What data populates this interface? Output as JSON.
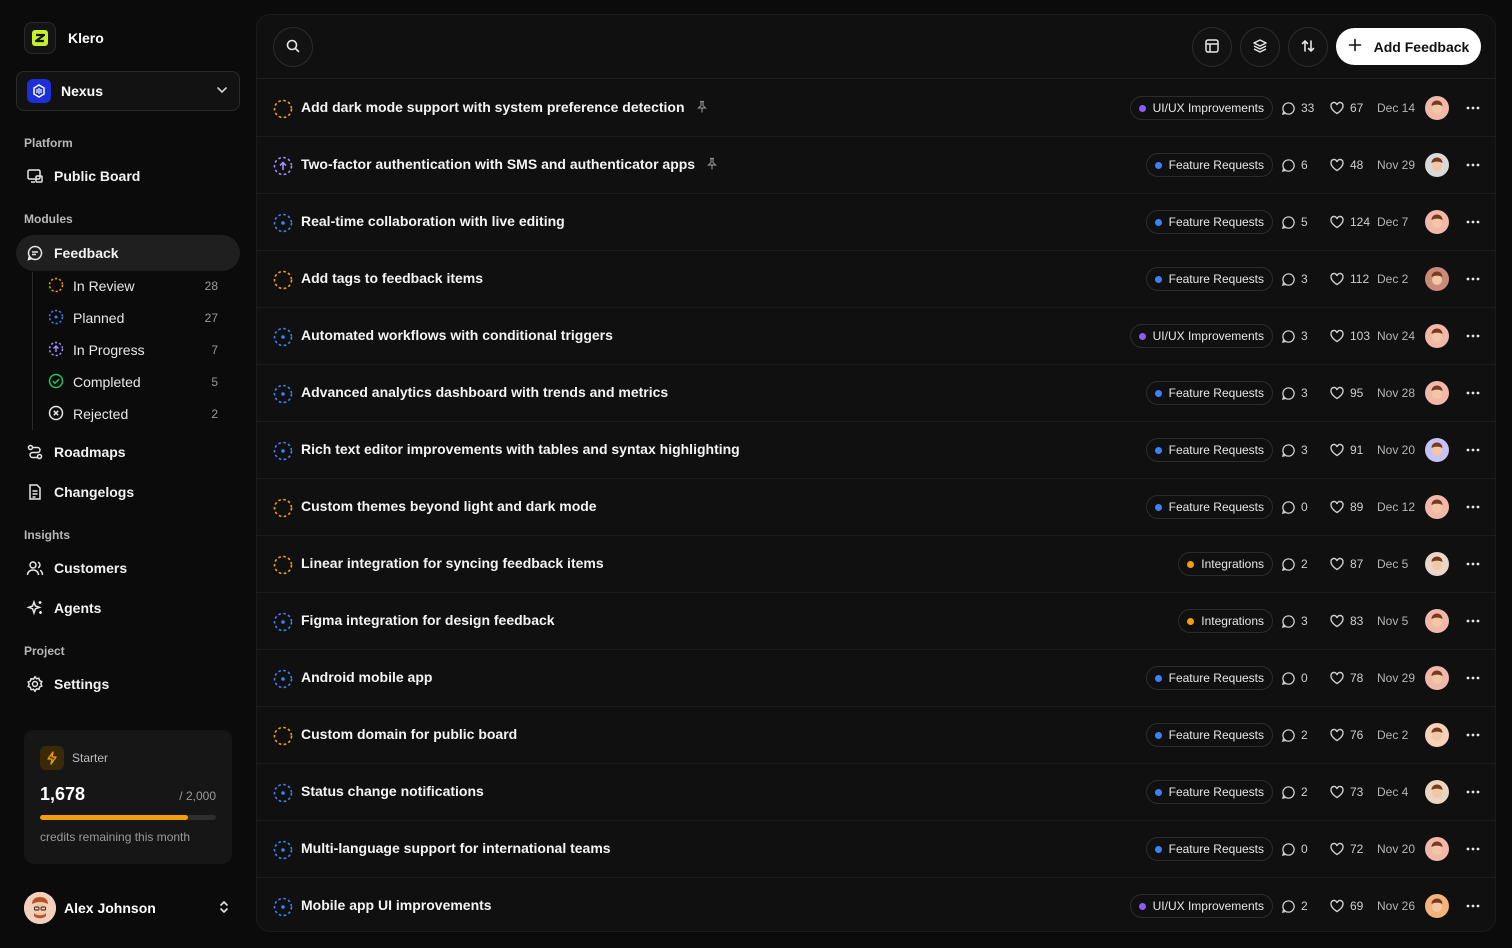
{
  "brand": {
    "name": "Klero"
  },
  "project": {
    "name": "Nexus"
  },
  "sidebar": {
    "platform_label": "Platform",
    "public_board": "Public Board",
    "modules_label": "Modules",
    "feedback": "Feedback",
    "statuses": [
      {
        "label": "In Review",
        "count": "28",
        "icon": "in-review-icon"
      },
      {
        "label": "Planned",
        "count": "27",
        "icon": "planned-icon"
      },
      {
        "label": "In Progress",
        "count": "7",
        "icon": "in-progress-icon"
      },
      {
        "label": "Completed",
        "count": "5",
        "icon": "completed-icon"
      },
      {
        "label": "Rejected",
        "count": "2",
        "icon": "rejected-icon"
      }
    ],
    "roadmaps": "Roadmaps",
    "changelogs": "Changelogs",
    "insights_label": "Insights",
    "customers": "Customers",
    "agents": "Agents",
    "project_label": "Project",
    "settings": "Settings"
  },
  "credits": {
    "plan": "Starter",
    "remaining": "1,678",
    "total": "/ 2,000",
    "fraction_used": 0.839,
    "note": "credits remaining this month"
  },
  "user": {
    "name": "Alex Johnson"
  },
  "toolbar": {
    "add_label": "Add Feedback"
  },
  "colors": {
    "ui_ux": "#8b5cf6",
    "feature": "#3b82f6",
    "integrations": "#f59e0b",
    "in_review": "#f59e0b",
    "planned": "#3b82f6",
    "in_progress": "#a78bfa",
    "completed": "#22c55e"
  },
  "feedback": [
    {
      "title": "Add dark mode support with system preference detection",
      "status": "in-review",
      "pinned": true,
      "tag": "UI/UX Improvements",
      "tag_color": "#8b5cf6",
      "comments": "33",
      "likes": "67",
      "date": "Dec 14",
      "avatar": "#f0b8a8"
    },
    {
      "title": "Two-factor authentication with SMS and authenticator apps",
      "status": "in-progress",
      "pinned": true,
      "tag": "Feature Requests",
      "tag_color": "#3b82f6",
      "comments": "6",
      "likes": "48",
      "date": "Nov 29",
      "avatar": "#d9d9d9"
    },
    {
      "title": "Real-time collaboration with live editing",
      "status": "planned",
      "pinned": false,
      "tag": "Feature Requests",
      "tag_color": "#3b82f6",
      "comments": "5",
      "likes": "124",
      "date": "Dec 7",
      "avatar": "#f0b8a8"
    },
    {
      "title": "Add tags to feedback items",
      "status": "in-review",
      "pinned": false,
      "tag": "Feature Requests",
      "tag_color": "#3b82f6",
      "comments": "3",
      "likes": "112",
      "date": "Dec 2",
      "avatar": "#c98a7a"
    },
    {
      "title": "Automated workflows with conditional triggers",
      "status": "planned",
      "pinned": false,
      "tag": "UI/UX Improvements",
      "tag_color": "#8b5cf6",
      "comments": "3",
      "likes": "103",
      "date": "Nov 24",
      "avatar": "#f0b8a8"
    },
    {
      "title": "Advanced analytics dashboard with trends and metrics",
      "status": "planned",
      "pinned": false,
      "tag": "Feature Requests",
      "tag_color": "#3b82f6",
      "comments": "3",
      "likes": "95",
      "date": "Nov 28",
      "avatar": "#f0b8a8"
    },
    {
      "title": "Rich text editor improvements with tables and syntax highlighting",
      "status": "planned",
      "pinned": false,
      "tag": "Feature Requests",
      "tag_color": "#3b82f6",
      "comments": "3",
      "likes": "91",
      "date": "Nov 20",
      "avatar": "#c7c2f4"
    },
    {
      "title": "Custom themes beyond light and dark mode",
      "status": "in-review",
      "pinned": false,
      "tag": "Feature Requests",
      "tag_color": "#3b82f6",
      "comments": "0",
      "likes": "89",
      "date": "Dec 12",
      "avatar": "#f0b8a8"
    },
    {
      "title": "Linear integration for syncing feedback items",
      "status": "in-review",
      "pinned": false,
      "tag": "Integrations",
      "tag_color": "#f59e0b",
      "comments": "2",
      "likes": "87",
      "date": "Dec 5",
      "avatar": "#ead7cc"
    },
    {
      "title": "Figma integration for design feedback",
      "status": "planned",
      "pinned": false,
      "tag": "Integrations",
      "tag_color": "#f59e0b",
      "comments": "3",
      "likes": "83",
      "date": "Nov 5",
      "avatar": "#f0b8a8"
    },
    {
      "title": "Android mobile app",
      "status": "planned",
      "pinned": false,
      "tag": "Feature Requests",
      "tag_color": "#3b82f6",
      "comments": "0",
      "likes": "78",
      "date": "Nov 29",
      "avatar": "#f0b8a8"
    },
    {
      "title": "Custom domain for public board",
      "status": "in-review",
      "pinned": false,
      "tag": "Feature Requests",
      "tag_color": "#3b82f6",
      "comments": "2",
      "likes": "76",
      "date": "Dec 2",
      "avatar": "#f6d2b8"
    },
    {
      "title": "Status change notifications",
      "status": "planned",
      "pinned": false,
      "tag": "Feature Requests",
      "tag_color": "#3b82f6",
      "comments": "2",
      "likes": "73",
      "date": "Dec 4",
      "avatar": "#e9d6c2"
    },
    {
      "title": "Multi-language support for international teams",
      "status": "planned",
      "pinned": false,
      "tag": "Feature Requests",
      "tag_color": "#3b82f6",
      "comments": "0",
      "likes": "72",
      "date": "Nov 20",
      "avatar": "#f0b8a8"
    },
    {
      "title": "Mobile app UI improvements",
      "status": "planned",
      "pinned": false,
      "tag": "UI/UX Improvements",
      "tag_color": "#8b5cf6",
      "comments": "2",
      "likes": "69",
      "date": "Nov 26",
      "avatar": "#f2b47a"
    }
  ]
}
